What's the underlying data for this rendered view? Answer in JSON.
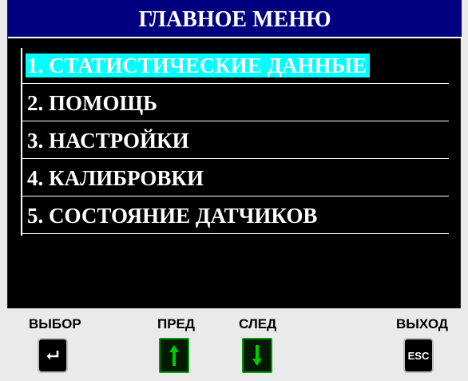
{
  "header": {
    "title": "ГЛАВНОЕ МЕНЮ"
  },
  "menu": {
    "items": [
      {
        "label": "1. СТАТИСТИЧЕСКИЕ ДАННЫЕ"
      },
      {
        "label": "2. ПОМОЩЬ"
      },
      {
        "label": "3. НАСТРОЙКИ"
      },
      {
        "label": "4. КАЛИБРОВКИ"
      },
      {
        "label": "5. СОСТОЯНИЕ ДАТЧИКОВ"
      }
    ],
    "selected_index": 0
  },
  "footer": {
    "select_label": "ВЫБОР",
    "prev_label": "ПРЕД",
    "next_label": "СЛЕД",
    "exit_label": "ВЫХОД",
    "esc_text": "ESC"
  },
  "colors": {
    "header_bg": "#000080",
    "selected_bg": "#00ffff",
    "screen_bg": "#000000",
    "arrow_green": "#00cc00"
  },
  "icons": {
    "select": "enter-arrow-icon",
    "prev": "arrow-up-icon",
    "next": "arrow-down-icon",
    "exit": "esc-key-icon"
  }
}
